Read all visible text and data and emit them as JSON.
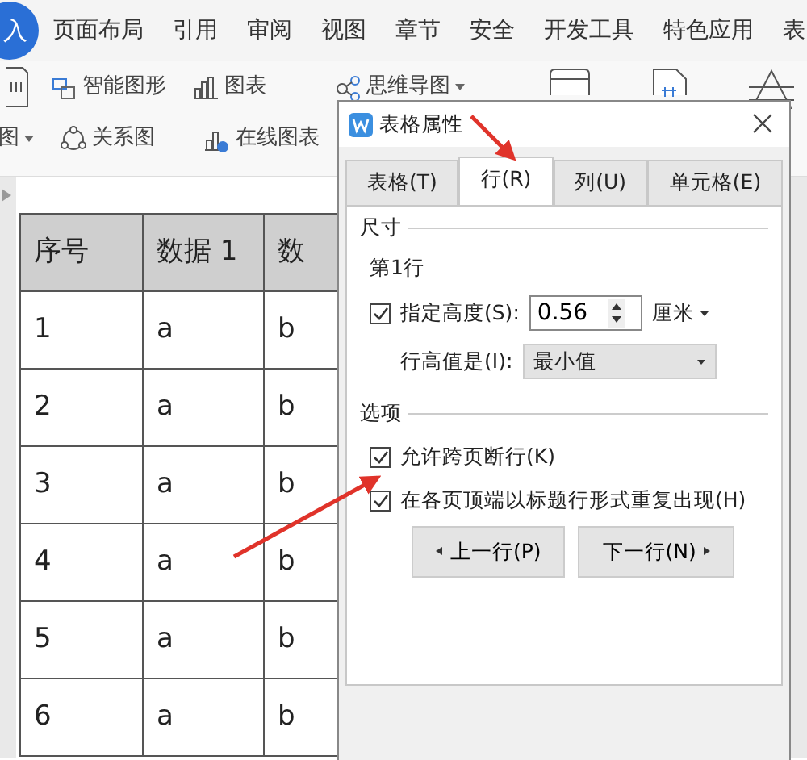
{
  "menu": {
    "logo": "入",
    "tabs": [
      {
        "label": "页面布局"
      },
      {
        "label": "引用"
      },
      {
        "label": "审阅"
      },
      {
        "label": "视图"
      },
      {
        "label": "章节"
      },
      {
        "label": "安全"
      },
      {
        "label": "开发工具"
      },
      {
        "label": "特色应用"
      },
      {
        "label": "表"
      }
    ]
  },
  "ribbon": {
    "top_items": [
      {
        "kind": "smartart",
        "label": "智能图形",
        "dropdown": false
      },
      {
        "kind": "chart",
        "label": "图表",
        "dropdown": false
      },
      {
        "kind": "mindmap",
        "label": "思维导图",
        "dropdown": true
      }
    ],
    "bottom_items": [
      {
        "kind": "none",
        "label": "图",
        "dropdown": true
      },
      {
        "kind": "relation",
        "label": "关系图",
        "dropdown": false
      },
      {
        "kind": "onlinechart",
        "label": "在线图表",
        "dropdown": false
      }
    ]
  },
  "table": {
    "columns": [
      "序号",
      "数据 1",
      "数"
    ],
    "rows": [
      [
        "1",
        "a",
        "b"
      ],
      [
        "2",
        "a",
        "b"
      ],
      [
        "3",
        "a",
        "b"
      ],
      [
        "4",
        "a",
        "b"
      ],
      [
        "5",
        "a",
        "b"
      ],
      [
        "6",
        "a",
        "b"
      ]
    ]
  },
  "dialog": {
    "title": "表格属性",
    "tabs": [
      {
        "label": "表格(T)",
        "selected": false
      },
      {
        "label": "行(R)",
        "selected": true
      },
      {
        "label": "列(U)",
        "selected": false
      },
      {
        "label": "单元格(E)",
        "selected": false
      }
    ],
    "size": {
      "title": "尺寸",
      "row_label": "第1行",
      "height": {
        "label": "指定高度(S):",
        "checked": true,
        "value": "0.56",
        "unit": "厘米"
      },
      "rule": {
        "label": "行高值是(I):",
        "value": "最小值"
      }
    },
    "options": {
      "title": "选项",
      "checkboxes": [
        {
          "label": "允许跨页断行(K)",
          "checked": true
        },
        {
          "label": "在各页顶端以标题行形式重复出现(H)",
          "checked": true
        }
      ]
    },
    "buttons": [
      {
        "label": "上一行(P)"
      },
      {
        "label": "下一行(N)"
      }
    ]
  }
}
